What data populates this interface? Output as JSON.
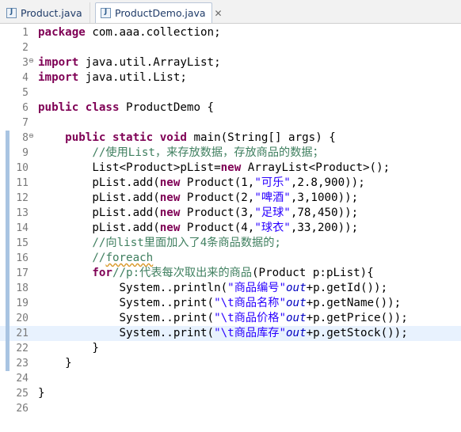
{
  "tabs": [
    {
      "label": "Product.java",
      "active": false
    },
    {
      "label": "ProductDemo.java",
      "active": true,
      "close": "✕"
    }
  ],
  "colors": {
    "keyword": "#7f0055",
    "string": "#2a00ff",
    "comment": "#3f7f5f",
    "static_field": "#0000c0",
    "current_line": "#e8f2fe"
  },
  "icons": {
    "tab_file": "java-file-icon",
    "fold": "fold-collapse-icon"
  },
  "editor": {
    "current_line": 21,
    "lines": [
      {
        "n": "1",
        "t": {
          "k1": "package",
          "a1": " com.aaa.collection;"
        }
      },
      {
        "n": "2",
        "t": {}
      },
      {
        "n": "3",
        "t": {
          "k1": "import",
          "a1": " java.util.ArrayList;"
        }
      },
      {
        "n": "4",
        "t": {
          "k1": "import",
          "a1": " java.util.List;"
        }
      },
      {
        "n": "5",
        "t": {}
      },
      {
        "n": "6",
        "t": {
          "k1": "public",
          "a1": " ",
          "k2": "class",
          "a2": " ProductDemo {"
        }
      },
      {
        "n": "7",
        "t": {}
      },
      {
        "n": "8",
        "t": {
          "a0": "    ",
          "k1": "public",
          "a1": " ",
          "k2": "static",
          "a2": " ",
          "k3": "void",
          "a3": " main(String[] args) {"
        }
      },
      {
        "n": "9",
        "t": {
          "a0": "        ",
          "c1": "//使用List，来存放数据，存放商品的数据；"
        }
      },
      {
        "n": "10",
        "t": {
          "a0": "        List<Product>pList=",
          "k1": "new",
          "a1": " ArrayList<Product>();"
        }
      },
      {
        "n": "11",
        "t": {
          "a0": "        pList.add(",
          "k1": "new",
          "a1": " Product(1,",
          "s1": "\"可乐\"",
          "a2": ",2.8,900));"
        }
      },
      {
        "n": "12",
        "t": {
          "a0": "        pList.add(",
          "k1": "new",
          "a1": " Product(2,",
          "s1": "\"啤酒\"",
          "a2": ",3,1000));"
        }
      },
      {
        "n": "13",
        "t": {
          "a0": "        pList.add(",
          "k1": "new",
          "a1": " Product(3,",
          "s1": "\"足球\"",
          "a2": ",78,450));"
        }
      },
      {
        "n": "14",
        "t": {
          "a0": "        pList.add(",
          "k1": "new",
          "a1": " Product(4,",
          "s1": "\"球衣\"",
          "a2": ",33,200));"
        }
      },
      {
        "n": "15",
        "t": {
          "a0": "        ",
          "c1": "//向list里面加入了4条商品数据的;"
        }
      },
      {
        "n": "16",
        "t": {
          "a0": "        ",
          "c1": "//",
          "w1": "foreach"
        }
      },
      {
        "n": "17",
        "t": {
          "a0": "        ",
          "k1": "for",
          "a1": "(Product p:pList){",
          "c1": "//p:代表每次取出来的商品"
        }
      },
      {
        "n": "18",
        "t": {
          "a0": "            System.",
          "i1": "out",
          "a1": ".println(",
          "s1": "\"商品编号\"",
          "a2": "+p.getId());"
        }
      },
      {
        "n": "19",
        "t": {
          "a0": "            System.",
          "i1": "out",
          "a1": ".print(",
          "s1": "\"\\t商品名称\"",
          "a2": "+p.getName());"
        }
      },
      {
        "n": "20",
        "t": {
          "a0": "            System.",
          "i1": "out",
          "a1": ".print(",
          "s1": "\"\\t商品价格\"",
          "a2": "+p.getPrice());"
        }
      },
      {
        "n": "21",
        "t": {
          "a0": "            System.",
          "i1": "out",
          "a1": ".print(",
          "s1": "\"\\t商品库存\"",
          "a2": "+p.getStock());"
        }
      },
      {
        "n": "22",
        "t": {
          "a0": "        }"
        }
      },
      {
        "n": "23",
        "t": {
          "a0": "    }"
        }
      },
      {
        "n": "24",
        "t": {}
      },
      {
        "n": "25",
        "t": {
          "a0": "}"
        }
      },
      {
        "n": "26",
        "t": {}
      }
    ]
  }
}
